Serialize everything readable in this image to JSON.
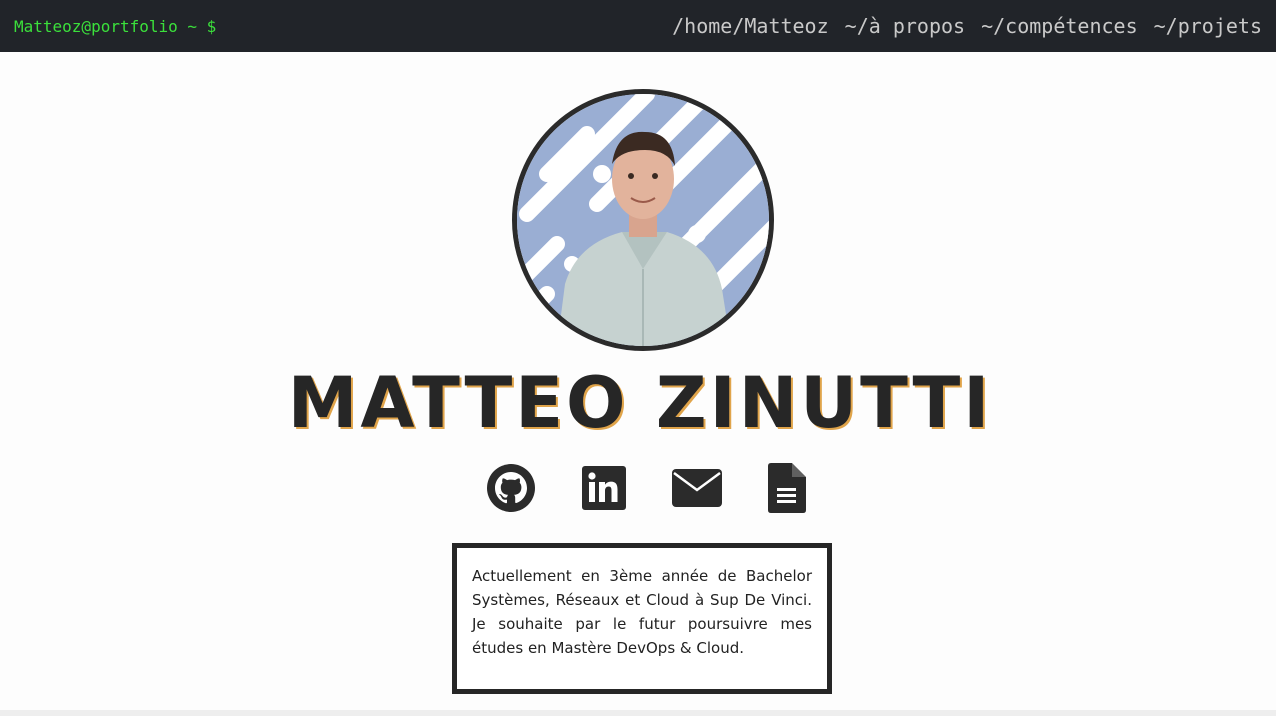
{
  "header": {
    "prompt": "Matteoz@portfolio ~ $",
    "nav": [
      {
        "label": "/home/Matteoz"
      },
      {
        "label": "~/à propos"
      },
      {
        "label": "~/compétences"
      },
      {
        "label": "~/projets"
      }
    ]
  },
  "profile": {
    "name": "MATTEO ZINUTTI",
    "bio": "Actuellement en 3ème année de Bachelor Systèmes, Réseaux et Cloud à Sup De Vinci. Je souhaite par le futur poursuivre mes études en Mastère DevOps & Cloud."
  },
  "socials": [
    {
      "icon": "github-icon"
    },
    {
      "icon": "linkedin-icon"
    },
    {
      "icon": "mail-icon"
    },
    {
      "icon": "document-icon"
    }
  ],
  "colors": {
    "topbar_bg": "#212429",
    "prompt": "#3be03b",
    "nav_text": "#c9c9c9",
    "dark": "#262626",
    "name_shadow": "#e0a44a",
    "avatar_pattern": "#9aaed3"
  }
}
